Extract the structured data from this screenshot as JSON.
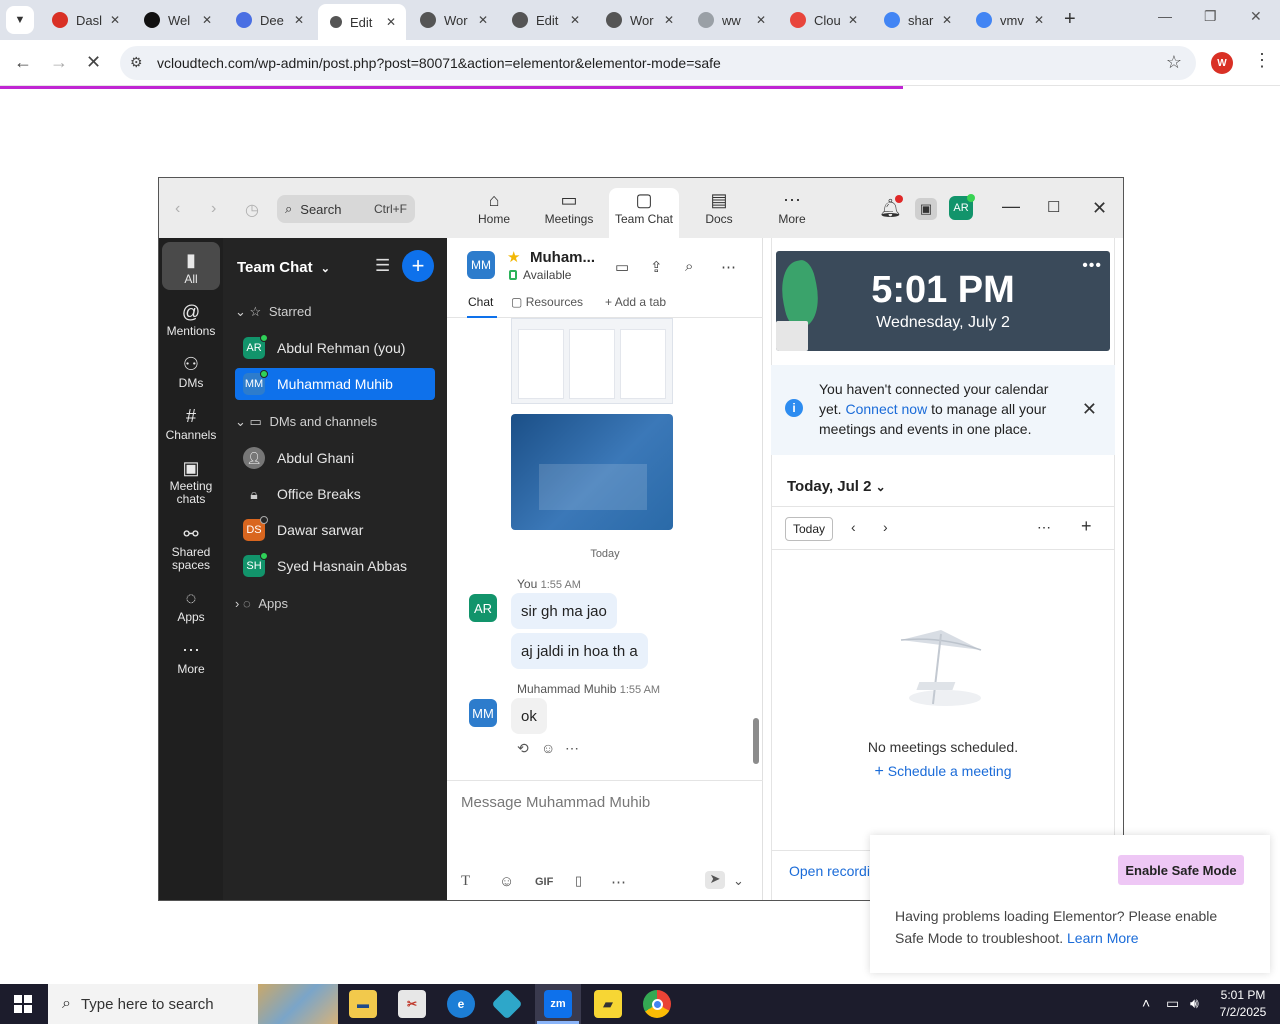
{
  "browser": {
    "tabs": [
      {
        "title": "Dasl",
        "color": "#d93025"
      },
      {
        "title": "Wel",
        "color": "#111111"
      },
      {
        "title": "Dee",
        "color": "#4a6fe3"
      },
      {
        "title": "Edit",
        "color": "#555555"
      },
      {
        "title": "Wor",
        "color": "#555555"
      },
      {
        "title": "Edit",
        "color": "#555555"
      },
      {
        "title": "Wor",
        "color": "#555555"
      },
      {
        "title": "ww",
        "color": "#9aa0a6"
      },
      {
        "title": "Clou",
        "color": "#e8453c"
      },
      {
        "title": "shar",
        "color": "#4285f4"
      },
      {
        "title": "vmv",
        "color": "#4285f4"
      }
    ],
    "active_tab_index": 3,
    "url": "vcloudtech.com/wp-admin/post.php?post=80071&action=elementor&elementor-mode=safe",
    "profile_initial": "W"
  },
  "zoom": {
    "search_label": "Search",
    "search_shortcut": "Ctrl+F",
    "top_tabs": [
      {
        "label": "Home",
        "icon": "⌂"
      },
      {
        "label": "Meetings",
        "icon": "▭"
      },
      {
        "label": "Team Chat",
        "icon": "▢"
      },
      {
        "label": "Docs",
        "icon": "▤"
      },
      {
        "label": "More",
        "icon": "⋯"
      }
    ],
    "user_initials": "AR",
    "rail": [
      {
        "label": "All",
        "icon": "▮"
      },
      {
        "label": "Mentions",
        "icon": "@"
      },
      {
        "label": "DMs",
        "icon": "⚇"
      },
      {
        "label": "Channels",
        "icon": "#"
      },
      {
        "label": "Meeting chats",
        "icon": "▣"
      },
      {
        "label": "Shared spaces",
        "icon": "⚯"
      },
      {
        "label": "Apps",
        "icon": "◌"
      },
      {
        "label": "More",
        "icon": "⋯"
      }
    ],
    "chat_list": {
      "title": "Team Chat",
      "starred_label": "Starred",
      "dms_label": "DMs and channels",
      "apps_label": "Apps",
      "starred": [
        {
          "name": "Abdul Rehman (you)",
          "initials": "AR",
          "color": "#12946b"
        },
        {
          "name": "Muhammad Muhib",
          "initials": "MM",
          "color": "#2d7ccc"
        }
      ],
      "dms": [
        {
          "name": "Abdul Ghani",
          "initials": "",
          "color": "#777777"
        },
        {
          "name": "Office Breaks",
          "initials": "",
          "color": "#242424"
        },
        {
          "name": "Dawar sarwar",
          "initials": "DS",
          "color": "#d9661f"
        },
        {
          "name": "Syed Hasnain Abbas",
          "initials": "SH",
          "color": "#12946b"
        }
      ]
    },
    "conversation": {
      "contact_initials": "MM",
      "contact_name": "Muham...",
      "status": "Available",
      "tabs": {
        "chat": "Chat",
        "resources": "Resources",
        "add": "Add a tab"
      },
      "day_separator": "Today",
      "messages": [
        {
          "sender": "You",
          "time": "1:55 AM",
          "initials": "AR",
          "bubbles": [
            "sir gh ma jao",
            "aj jaldi in hoa th a"
          ]
        },
        {
          "sender": "Muhammad Muhib",
          "time": "1:55 AM",
          "initials": "MM",
          "bubbles": [
            "ok"
          ]
        }
      ],
      "composer_placeholder": "Message Muhammad Muhib",
      "gif_label": "GIF"
    },
    "right_panel": {
      "time": "5:01 PM",
      "date": "Wednesday, July 2",
      "calendar_notice_pre": "You haven't connected your calendar yet.",
      "calendar_notice_link": "Connect now",
      "calendar_notice_post": "to manage all your meetings and events in one place.",
      "today_header": "Today, Jul 2",
      "today_button": "Today",
      "no_meetings": "No meetings scheduled.",
      "schedule": "Schedule a meeting",
      "open_recordings": "Open recordings"
    }
  },
  "elementor": {
    "button": "Enable Safe Mode",
    "message": "Having problems loading Elementor? Please enable Safe Mode to troubleshoot.",
    "link": "Learn More"
  },
  "taskbar": {
    "search_placeholder": "Type here to search",
    "time": "5:01 PM",
    "date": "7/2/2025",
    "zoom_label": "zm"
  }
}
